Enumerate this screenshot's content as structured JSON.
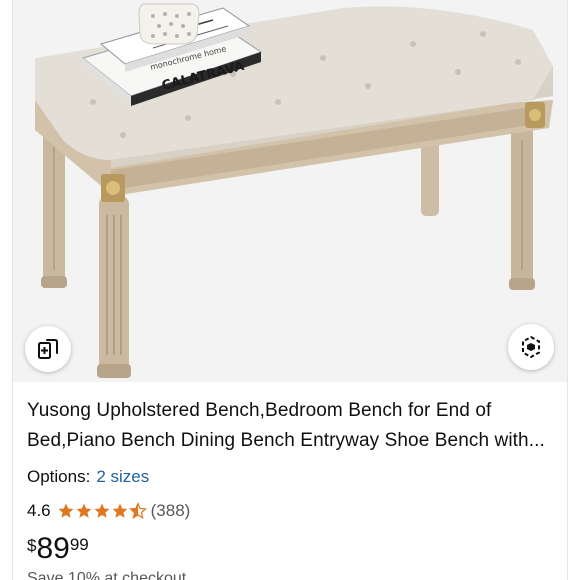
{
  "product": {
    "title": "Yusong Upholstered Bench,Bedroom Bench for End of Bed,Piano Bench Dining Bench Entryway Shoe Bench with...",
    "options_label": "Options:",
    "options_value": "2 sizes",
    "rating_value": "4.6",
    "rating_fraction": 0.92,
    "review_count": "(388)",
    "price_symbol": "$",
    "price_whole": "89",
    "price_fraction": "99",
    "savings_text": "Save 10% at checkout"
  },
  "image": {
    "book_text_top": "monochrome home",
    "book_text_bottom": "CALATRAVA"
  },
  "icons": {
    "compare": "compare-cards-icon",
    "view_3d": "view-3d-icon",
    "star": "star-icon"
  },
  "colors": {
    "star": "#de7921",
    "link": "#2162a1",
    "image_bg": "#f3f3f3"
  }
}
